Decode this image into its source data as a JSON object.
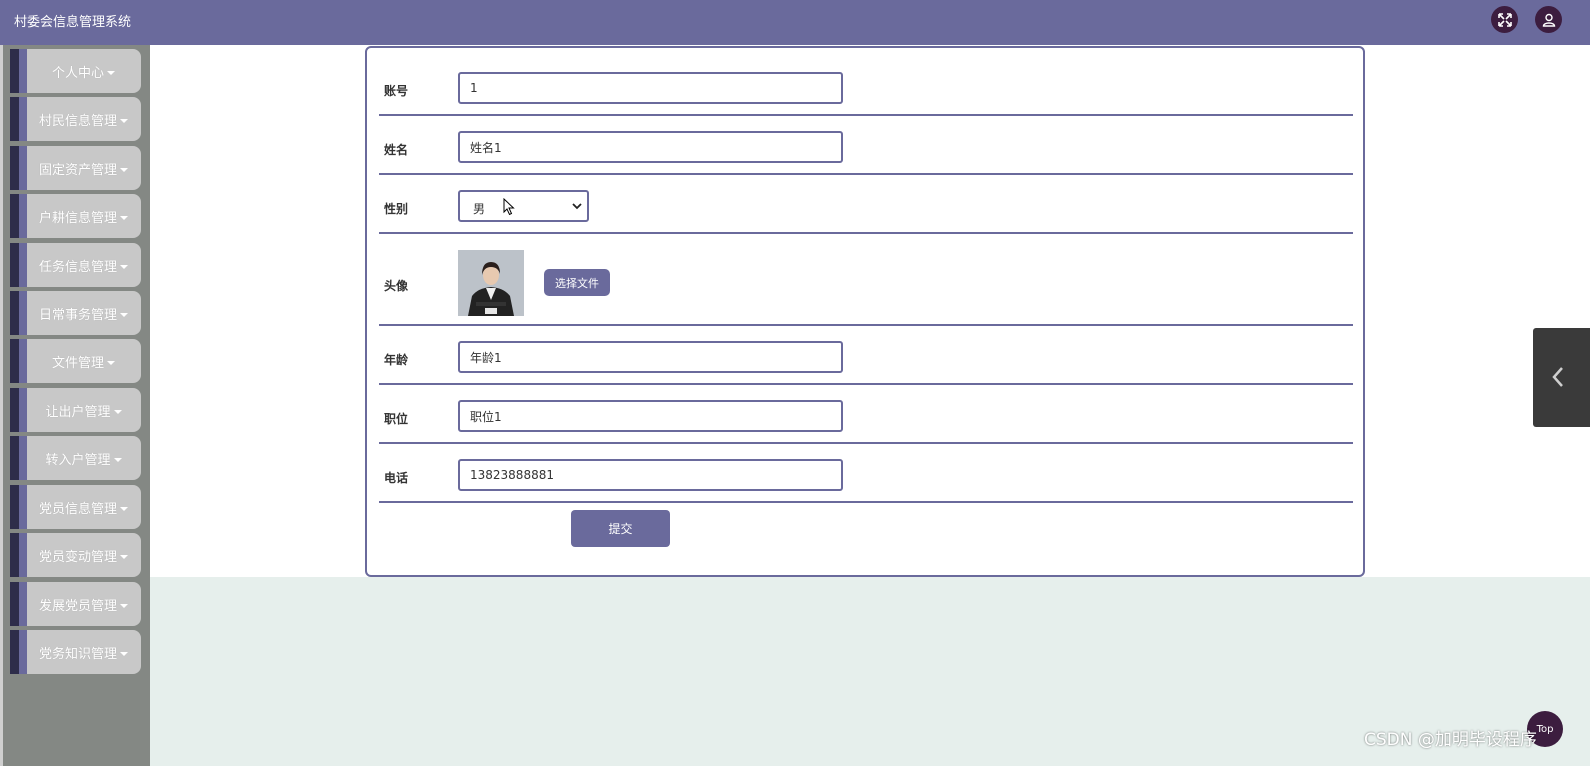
{
  "app": {
    "title": "村委会信息管理系统"
  },
  "colors": {
    "primary": "#6a6a9c",
    "sidebar_bg": "#848884",
    "menu_item_bg": "#c8c8c8",
    "dark_accent": "#2e2d4a",
    "header_icon_bg": "#3c1d3f",
    "footer_bg": "#e6efec"
  },
  "header": {
    "expand_icon": "fullscreen-icon",
    "user_icon": "user-icon"
  },
  "sidebar": {
    "items": [
      {
        "label": "个人中心"
      },
      {
        "label": "村民信息管理"
      },
      {
        "label": "固定资产管理"
      },
      {
        "label": "户耕信息管理"
      },
      {
        "label": "任务信息管理"
      },
      {
        "label": "日常事务管理"
      },
      {
        "label": "文件管理"
      },
      {
        "label": "让出户管理"
      },
      {
        "label": "转入户管理"
      },
      {
        "label": "党员信息管理"
      },
      {
        "label": "党员变动管理"
      },
      {
        "label": "发展党员管理"
      },
      {
        "label": "党务知识管理"
      }
    ]
  },
  "form": {
    "account": {
      "label": "账号",
      "value": "1"
    },
    "name": {
      "label": "姓名",
      "value": "姓名1"
    },
    "gender": {
      "label": "性别",
      "value": "男"
    },
    "avatar": {
      "label": "头像",
      "button": "选择文件"
    },
    "age": {
      "label": "年龄",
      "value": "年龄1"
    },
    "position": {
      "label": "职位",
      "value": "职位1"
    },
    "phone": {
      "label": "电话",
      "value": "13823888881"
    },
    "submit": "提交"
  },
  "floating": {
    "top_button": "Top",
    "side_tab_icon": "chevron-left-icon"
  },
  "watermark": "CSDN @加明毕设程序"
}
